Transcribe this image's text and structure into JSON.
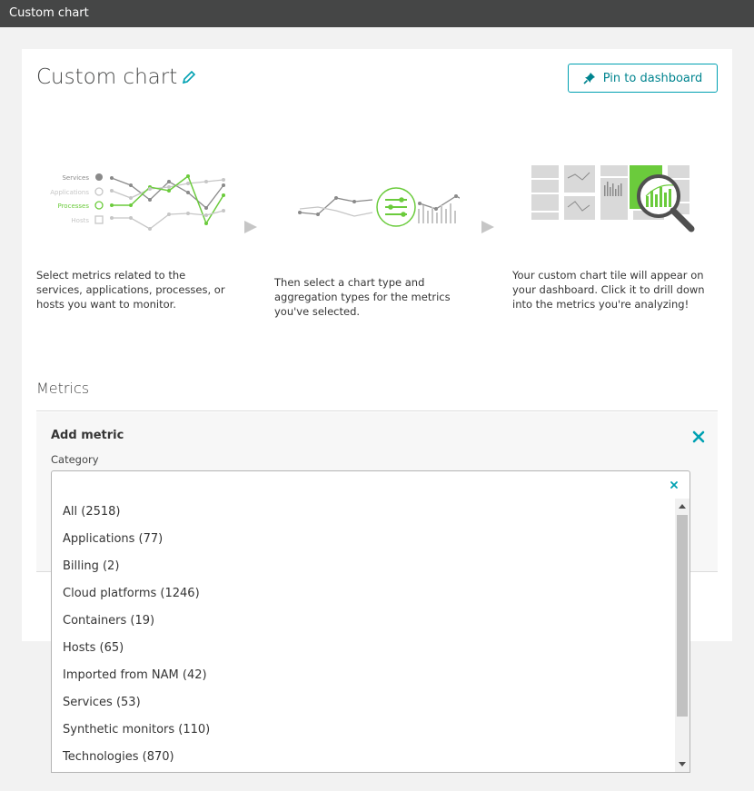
{
  "window": {
    "title": "Custom chart"
  },
  "header": {
    "title": "Custom chart",
    "pin_button": "Pin to dashboard"
  },
  "steps": [
    {
      "legend": [
        "Services",
        "Applications",
        "Processes",
        "Hosts"
      ],
      "text": "Select metrics related to the services, applications, processes, or hosts you want to monitor."
    },
    {
      "text": "Then select a chart type and aggregation types for the metrics you've selected."
    },
    {
      "text": "Your custom chart tile will appear on your dashboard. Click it to drill down into the metrics you're analyzing!"
    }
  ],
  "metrics": {
    "title": "Metrics",
    "add_metric": {
      "title": "Add metric",
      "category_label": "Category",
      "category_value": "",
      "options": [
        "All (2518)",
        "Applications (77)",
        "Billing (2)",
        "Cloud platforms (1246)",
        "Containers (19)",
        "Hosts (65)",
        "Imported from NAM (42)",
        "Services (53)",
        "Synthetic monitors (110)",
        "Technologies (870)"
      ]
    }
  },
  "colors": {
    "accent": "#00a1b2",
    "green": "#6bcb3c",
    "titlebar": "#454646"
  }
}
